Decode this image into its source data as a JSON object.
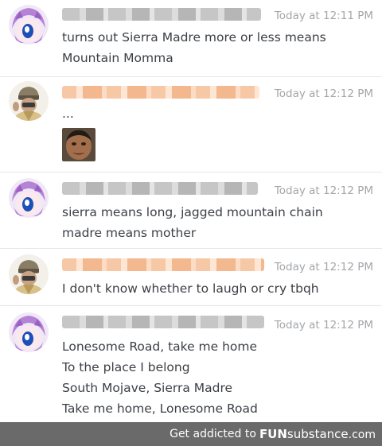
{
  "messages": [
    {
      "author_color": "gray",
      "timestamp": "Today at 12:11 PM",
      "lines": [
        "turns out Sierra Madre more or less means",
        "Mountain Momma"
      ],
      "avatar": "anime-girl-avatar"
    },
    {
      "author_color": "orange",
      "timestamp": "Today at 12:12 PM",
      "lines": [
        "..."
      ],
      "avatar": "masked-man-avatar",
      "attachment": "face-emoji"
    },
    {
      "author_color": "gray",
      "timestamp": "Today at 12:12 PM",
      "lines": [
        "sierra means long, jagged mountain chain",
        "madre means mother"
      ],
      "avatar": "anime-girl-avatar"
    },
    {
      "author_color": "orange",
      "timestamp": "Today at 12:12 PM",
      "lines": [
        "I don't know whether to laugh or cry tbqh"
      ],
      "avatar": "masked-man-avatar"
    },
    {
      "author_color": "gray",
      "timestamp": "Today at 12:12 PM",
      "lines": [
        "Lonesome Road, take me home",
        "To the place I belong",
        "South Mojave, Sierra Madre",
        "Take me home, Lonesome Road"
      ],
      "avatar": "anime-girl-avatar"
    }
  ],
  "footer": {
    "prefix": "Get addicted to",
    "brand": "FUN",
    "brand_rest": "substance",
    "suffix": ".com"
  },
  "colors": {
    "timestamp": "#a3a6aa",
    "text": "#3b3f45",
    "footer_bg": "#6a6a6a"
  }
}
